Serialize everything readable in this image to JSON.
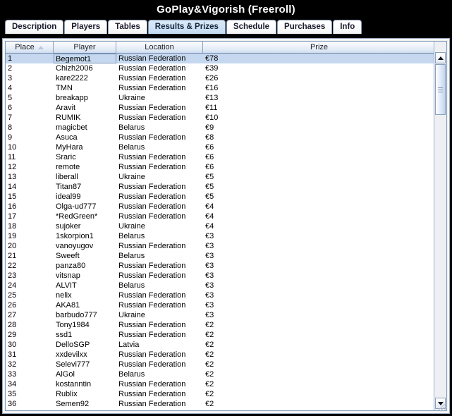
{
  "window": {
    "title": "GoPlay&Vigorish (Freeroll)"
  },
  "tabs": [
    {
      "label": "Description",
      "active": false
    },
    {
      "label": "Players",
      "active": false
    },
    {
      "label": "Tables",
      "active": false
    },
    {
      "label": "Results & Prizes",
      "active": true
    },
    {
      "label": "Schedule",
      "active": false
    },
    {
      "label": "Purchases",
      "active": false
    },
    {
      "label": "Info",
      "active": false
    }
  ],
  "table": {
    "columns": [
      {
        "key": "place",
        "label": "Place",
        "sort": "asc"
      },
      {
        "key": "player",
        "label": "Player",
        "sort": "none"
      },
      {
        "key": "location",
        "label": "Location",
        "sort": "none"
      },
      {
        "key": "prize",
        "label": "Prize",
        "sort": "none"
      }
    ],
    "selected_row_index": 0,
    "rows": [
      {
        "place": "1",
        "player": "Begemot1",
        "location": "Russian Federation",
        "prize": "€78"
      },
      {
        "place": "2",
        "player": "Chizh2006",
        "location": "Russian Federation",
        "prize": "€39"
      },
      {
        "place": "3",
        "player": "kare2222",
        "location": "Russian Federation",
        "prize": "€26"
      },
      {
        "place": "4",
        "player": "TMN",
        "location": "Russian Federation",
        "prize": "€16"
      },
      {
        "place": "5",
        "player": "breakapp",
        "location": "Ukraine",
        "prize": "€13"
      },
      {
        "place": "6",
        "player": "Aravit",
        "location": "Russian Federation",
        "prize": "€11"
      },
      {
        "place": "7",
        "player": "RUMIK",
        "location": "Russian Federation",
        "prize": "€10"
      },
      {
        "place": "8",
        "player": "magicbet",
        "location": "Belarus",
        "prize": "€9"
      },
      {
        "place": "9",
        "player": "Asuca",
        "location": "Russian Federation",
        "prize": "€8"
      },
      {
        "place": "10",
        "player": "MyHara",
        "location": "Belarus",
        "prize": "€6"
      },
      {
        "place": "11",
        "player": "Sraric",
        "location": "Russian Federation",
        "prize": "€6"
      },
      {
        "place": "12",
        "player": "remote",
        "location": "Russian Federation",
        "prize": "€6"
      },
      {
        "place": "13",
        "player": "liberall",
        "location": "Ukraine",
        "prize": "€5"
      },
      {
        "place": "14",
        "player": "Titan87",
        "location": "Russian Federation",
        "prize": "€5"
      },
      {
        "place": "15",
        "player": "ideal99",
        "location": "Russian Federation",
        "prize": "€5"
      },
      {
        "place": "16",
        "player": "Olga-ud777",
        "location": "Russian Federation",
        "prize": "€4"
      },
      {
        "place": "17",
        "player": "*RedGreen*",
        "location": "Russian Federation",
        "prize": "€4"
      },
      {
        "place": "18",
        "player": "sujoker",
        "location": "Ukraine",
        "prize": "€4"
      },
      {
        "place": "19",
        "player": "1skorpion1",
        "location": "Belarus",
        "prize": "€3"
      },
      {
        "place": "20",
        "player": "vanoyugov",
        "location": "Russian Federation",
        "prize": "€3"
      },
      {
        "place": "21",
        "player": "Sweeft",
        "location": "Belarus",
        "prize": "€3"
      },
      {
        "place": "22",
        "player": "panza80",
        "location": "Russian Federation",
        "prize": "€3"
      },
      {
        "place": "23",
        "player": "vitsnap",
        "location": "Russian Federation",
        "prize": "€3"
      },
      {
        "place": "24",
        "player": "ALVIT",
        "location": "Belarus",
        "prize": "€3"
      },
      {
        "place": "25",
        "player": "nelix",
        "location": "Russian Federation",
        "prize": "€3"
      },
      {
        "place": "26",
        "player": "AKA81",
        "location": "Russian Federation",
        "prize": "€3"
      },
      {
        "place": "27",
        "player": "barbudo777",
        "location": "Ukraine",
        "prize": "€3"
      },
      {
        "place": "28",
        "player": "Tony1984",
        "location": "Russian Federation",
        "prize": "€2"
      },
      {
        "place": "29",
        "player": "ssd1",
        "location": "Russian Federation",
        "prize": "€2"
      },
      {
        "place": "30",
        "player": "DelloSGP",
        "location": "Latvia",
        "prize": "€2"
      },
      {
        "place": "31",
        "player": "xxdevilxx",
        "location": "Russian Federation",
        "prize": "€2"
      },
      {
        "place": "32",
        "player": "Selevi777",
        "location": "Russian Federation",
        "prize": "€2"
      },
      {
        "place": "33",
        "player": "AlGol",
        "location": "Belarus",
        "prize": "€2"
      },
      {
        "place": "34",
        "player": "kostanntin",
        "location": "Russian Federation",
        "prize": "€2"
      },
      {
        "place": "35",
        "player": "Rublix",
        "location": "Russian Federation",
        "prize": "€2"
      },
      {
        "place": "36",
        "player": "Semen92",
        "location": "Russian Federation",
        "prize": "€2"
      }
    ]
  },
  "scrollbar": {
    "up_icon": "triangle-up-icon",
    "down_icon": "triangle-down-icon",
    "thumb_grip_icon": "grip-lines-icon"
  },
  "colors": {
    "accent": "#c5d8ef",
    "header_gradient_top": "#fbfcfe",
    "header_gradient_bottom": "#c9d9ee",
    "panel_border": "#7f9bbd",
    "title_bg": "#000000",
    "title_fg": "#ffffff"
  }
}
